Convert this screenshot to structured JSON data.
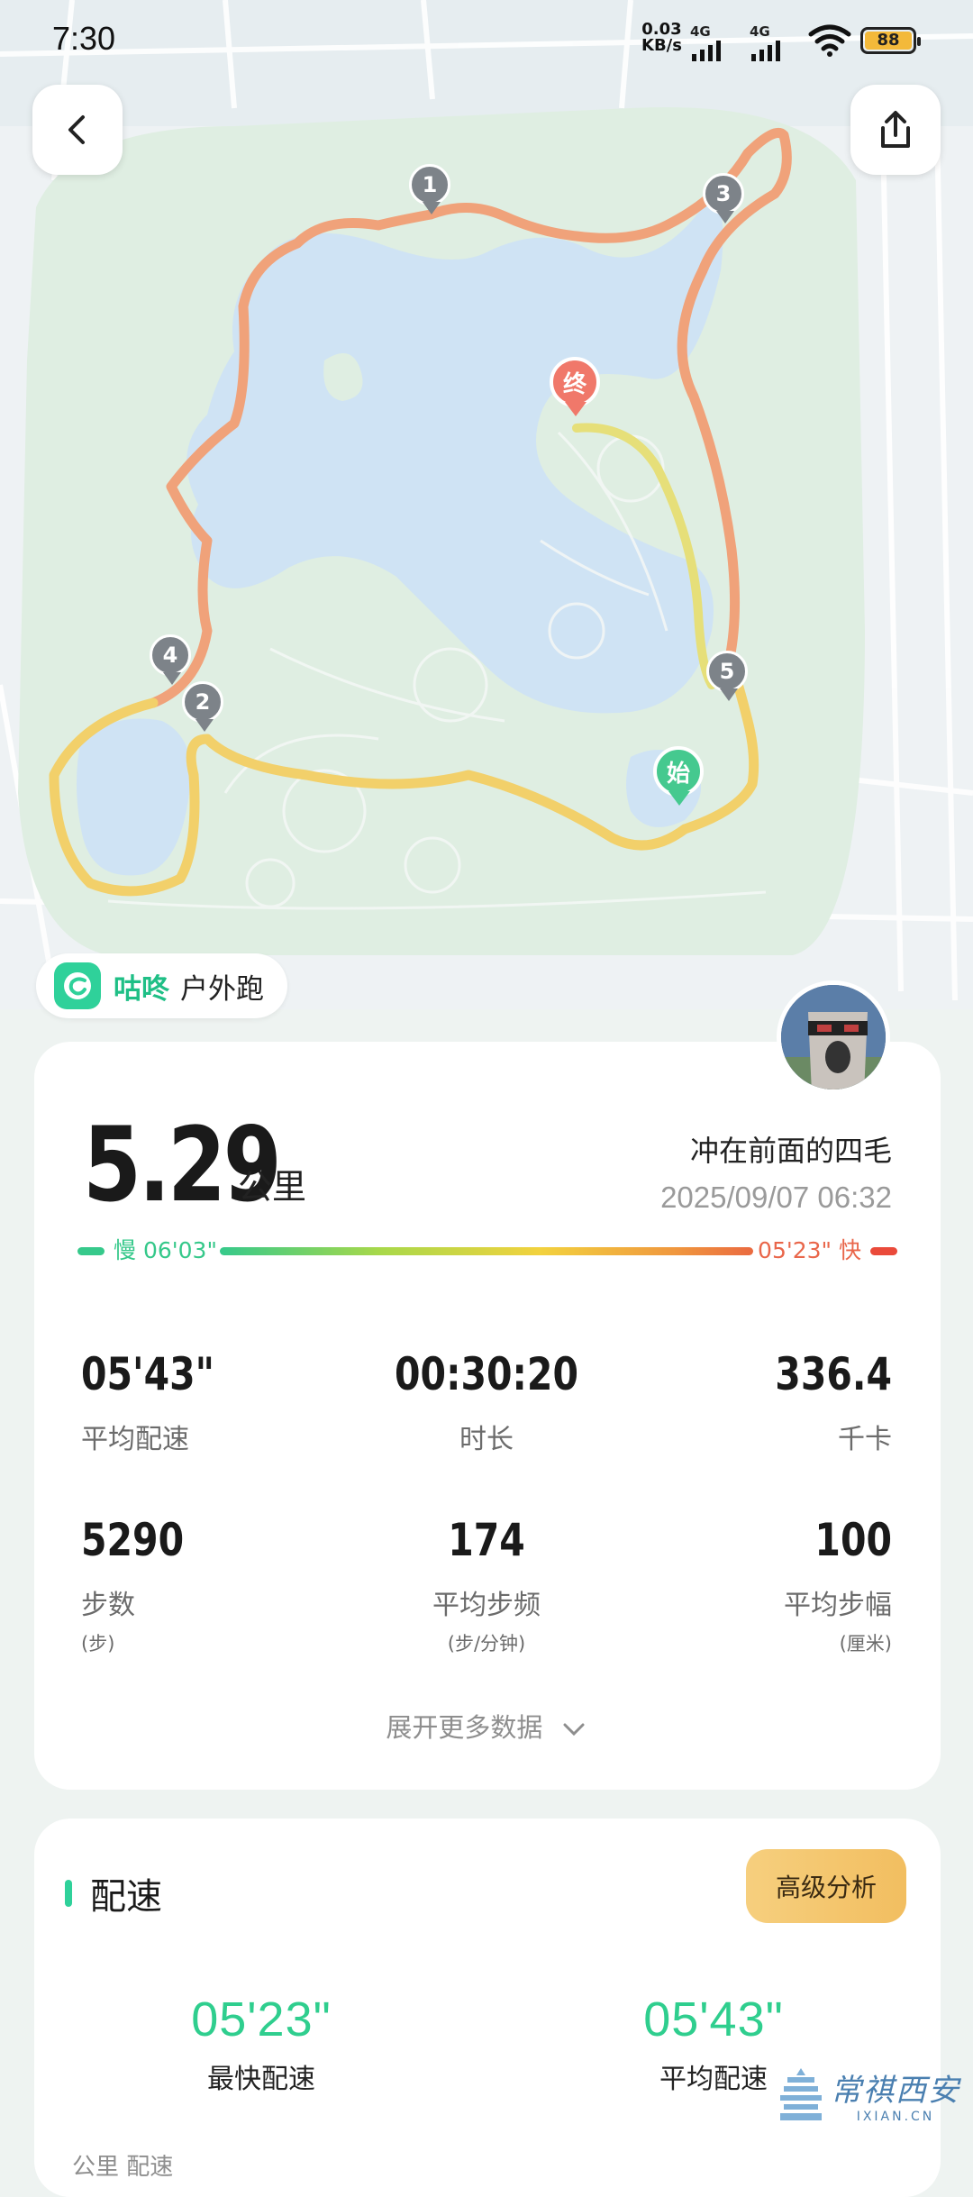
{
  "status_bar": {
    "time": "7:30",
    "net_speed_value": "0.03",
    "net_speed_unit": "KB/s",
    "network_1": "4G",
    "network_2": "4G",
    "battery": "88"
  },
  "map_markers": {
    "checkpoints": [
      "1",
      "2",
      "3",
      "4",
      "5"
    ],
    "start_label": "始",
    "end_label": "终"
  },
  "brand": {
    "name": "咕咚",
    "activity": "户外跑"
  },
  "summary": {
    "distance": "5.29",
    "distance_unit": "公里",
    "user_name": "冲在前面的四毛",
    "date": "2025/09/07 06:32",
    "pace_slow_label": "慢 06'03\"",
    "pace_fast_label": "05'23\" 快",
    "stats": [
      {
        "value": "05'43\"",
        "label": "平均配速",
        "sub": ""
      },
      {
        "value": "00:30:20",
        "label": "时长",
        "sub": ""
      },
      {
        "value": "336.4",
        "label": "千卡",
        "sub": ""
      },
      {
        "value": "5290",
        "label": "步数",
        "sub": "(步)"
      },
      {
        "value": "174",
        "label": "平均步频",
        "sub": "(步/分钟)"
      },
      {
        "value": "100",
        "label": "平均步幅",
        "sub": "(厘米)"
      }
    ],
    "expand_label": "展开更多数据"
  },
  "pace_section": {
    "title": "配速",
    "advanced_button": "高级分析",
    "fastest_value": "05'23\"",
    "fastest_label": "最快配速",
    "average_value": "05'43\"",
    "average_label": "平均配速",
    "bottom_partial": "公里    配速"
  },
  "watermark": {
    "text": "常祺西安",
    "url": "IXIAN.CN"
  },
  "colors": {
    "accent_green": "#2fd19a",
    "route_orange": "#f0a27a",
    "route_yellow": "#f2d76a",
    "lake_blue": "#cfe3f4",
    "slow_green": "#36c98b",
    "fast_red": "#ea4a3a",
    "marker_gray": "#7d8389",
    "end_pin": "#f0786a",
    "start_pin": "#45c98f"
  },
  "icons": {
    "back": "chevron-left-icon",
    "share": "share-icon",
    "expand": "chevron-down-icon"
  }
}
